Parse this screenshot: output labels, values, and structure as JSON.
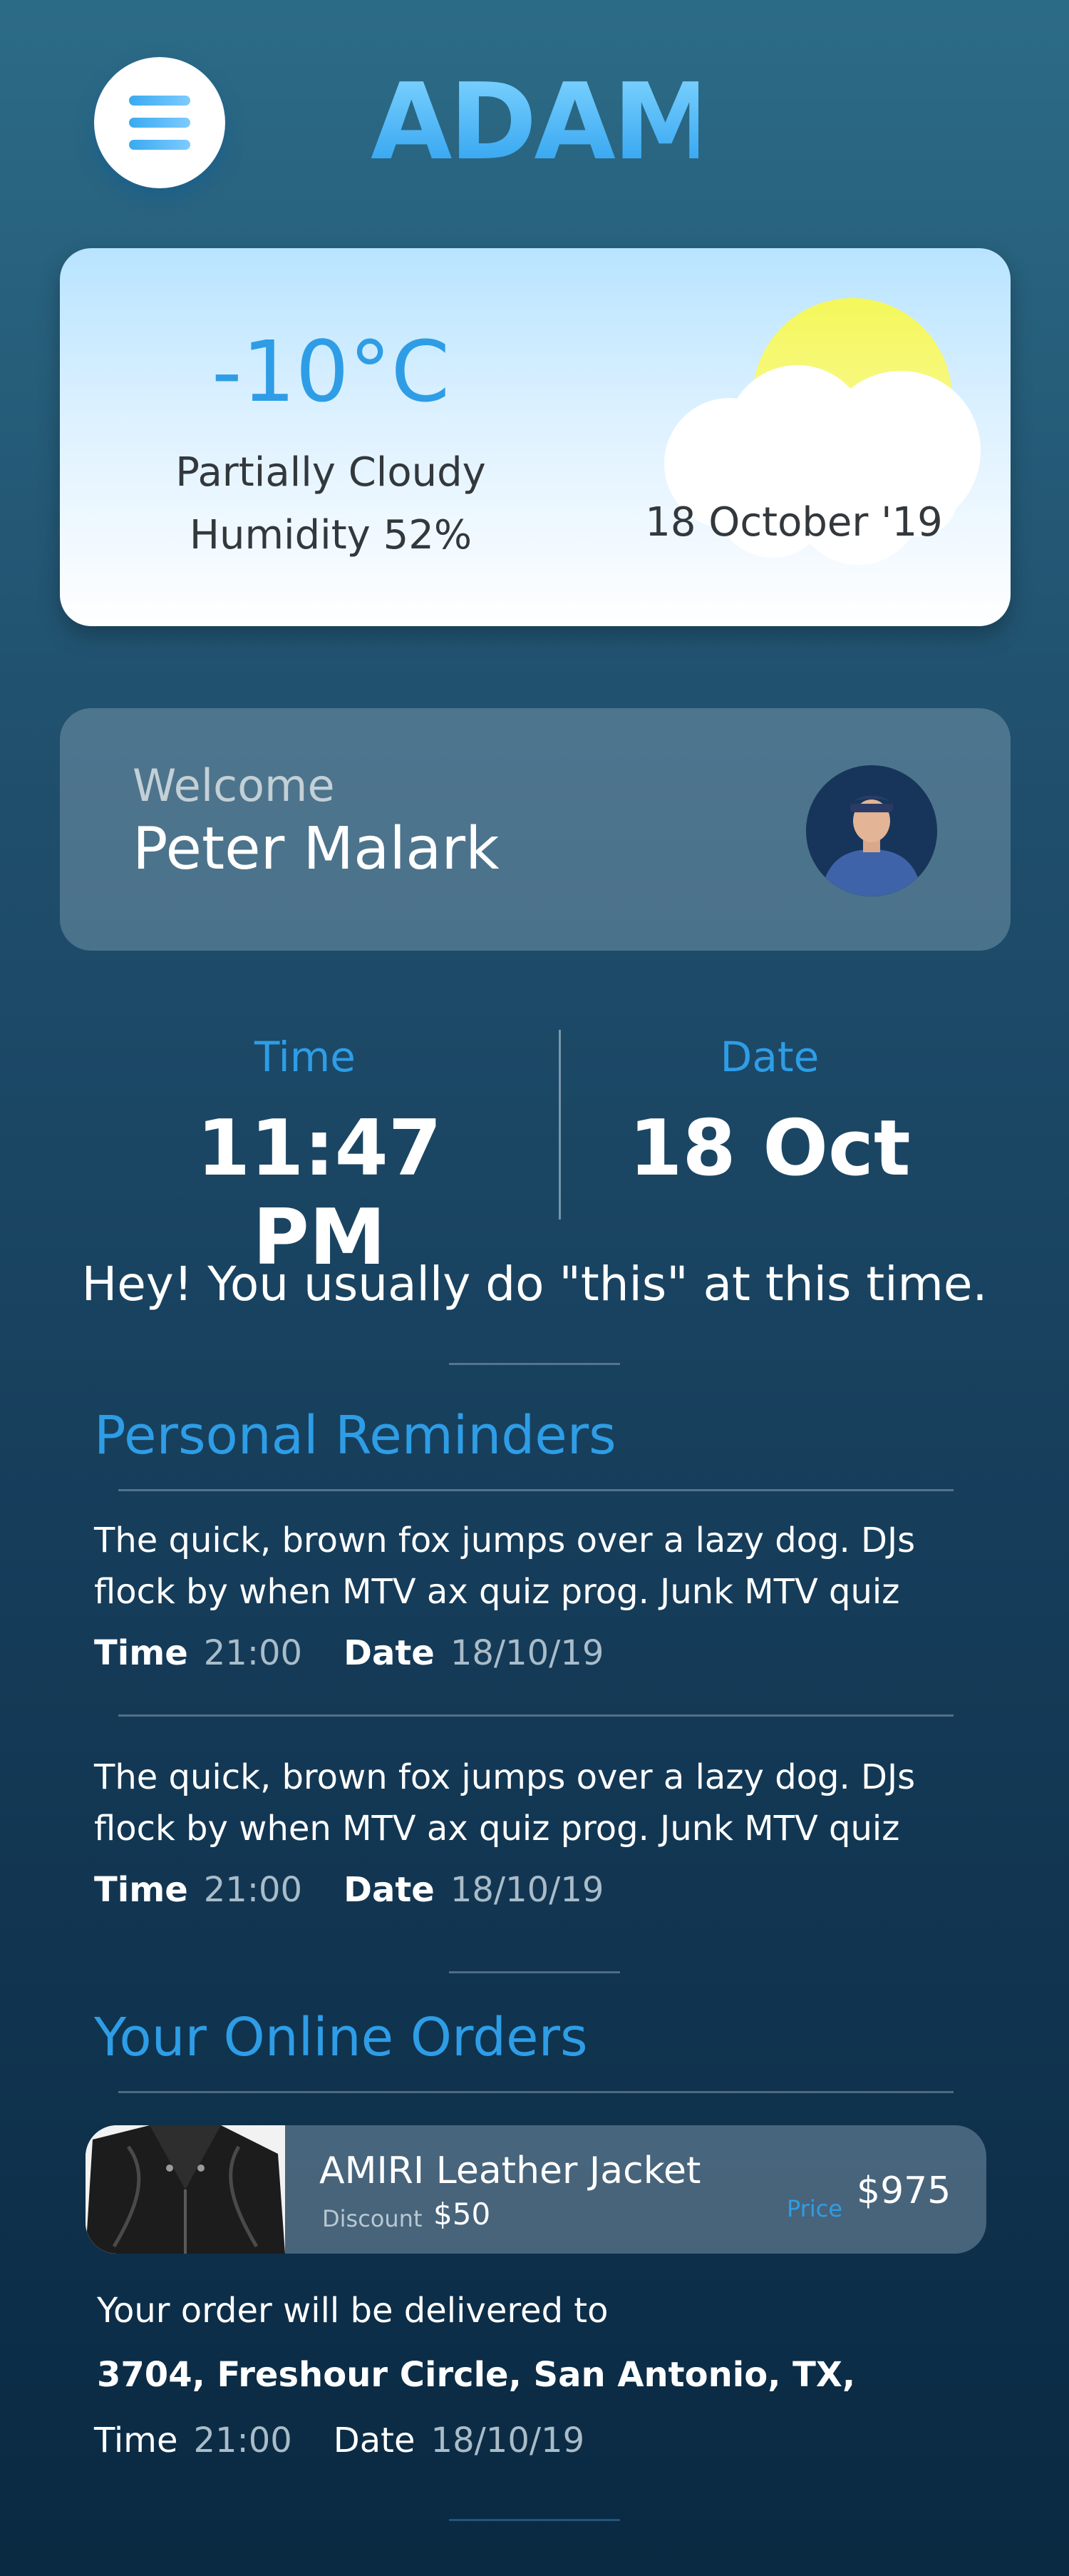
{
  "header": {
    "menu_icon": "hamburger-menu-icon",
    "logo_text": "ADAM"
  },
  "weather": {
    "temperature": "-10°C",
    "condition": "Partially Cloudy",
    "humidity": "Humidity 52%",
    "date": "18 October '19",
    "icon": "partly-cloudy-sun-icon",
    "sun_color": "#f6f96a"
  },
  "welcome": {
    "label": "Welcome",
    "name": "Peter Malark",
    "avatar_icon": "user-avatar"
  },
  "clock": {
    "time_label": "Time",
    "time_value": "11:47 PM",
    "date_label": "Date",
    "date_value": "18 Oct"
  },
  "hint": "Hey! You usually do \"this\" at this time.",
  "reminders": {
    "title": "Personal Reminders",
    "items": [
      {
        "line1": "The quick, brown fox jumps over a lazy dog. DJs",
        "line2": "flock by when MTV ax quiz prog. Junk MTV quiz",
        "time_label": "Time",
        "time": "21:00",
        "date_label": "Date",
        "date": "18/10/19"
      },
      {
        "line1": "The quick, brown fox jumps over a lazy dog. DJs",
        "line2": "flock by when MTV ax quiz prog. Junk MTV quiz",
        "time_label": "Time",
        "time": "21:00",
        "date_label": "Date",
        "date": "18/10/19"
      }
    ]
  },
  "orders": {
    "title": "Your Online Orders",
    "items": [
      {
        "name": "AMIRI Leather Jacket",
        "discount_label": "Discount",
        "discount": "$50",
        "price_label": "Price",
        "price": "$975",
        "image_icon": "leather-jacket-image",
        "delivery_text": "Your order will be delivered to",
        "address": "3704, Freshour Circle, San Antonio, TX,",
        "time_label": "Time",
        "time": "21:00",
        "date_label": "Date",
        "date": "18/10/19"
      }
    ]
  },
  "colors": {
    "accent": "#2e9de6",
    "background_top": "#2c6b86",
    "background_bottom": "#0a2942"
  }
}
